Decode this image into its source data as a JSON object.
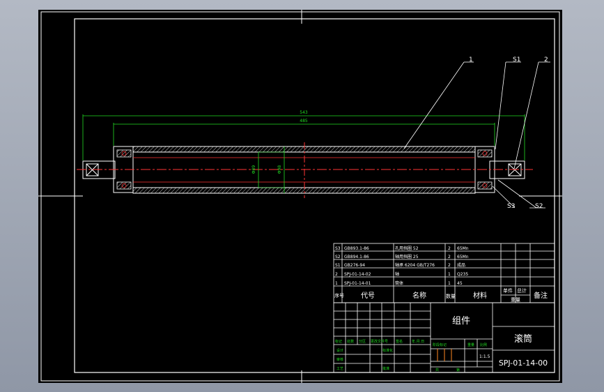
{
  "drawing": {
    "dimensions": {
      "overall_length": "543",
      "tube_length": "485",
      "inner_dia": "Φ89",
      "outer_dia": "Φ98"
    },
    "balloons": {
      "part1": "1",
      "s1": "S1",
      "part2": "2",
      "s3": "S3",
      "s2": "S2"
    }
  },
  "bom": {
    "rows": [
      {
        "no": "S3",
        "code": "GB893.1-86",
        "name": "孔用挡圈 52",
        "qty": "2",
        "material": "65Mn"
      },
      {
        "no": "S2",
        "code": "GB894.1-86",
        "name": "轴用挡圈 25",
        "qty": "2",
        "material": "65Mn"
      },
      {
        "no": "S1",
        "code": "GB276-94",
        "name": "轴承 6204 GB/T276",
        "qty": "2",
        "material": "成品"
      },
      {
        "no": "2",
        "code": "SPJ-01-14-02",
        "name": "轴",
        "qty": "1",
        "material": "Q235"
      },
      {
        "no": "1",
        "code": "SPJ-01-14-01",
        "name": "筒体",
        "qty": "1",
        "material": "45"
      }
    ],
    "headers": {
      "no": "序号",
      "code": "代号",
      "name": "名称",
      "qty": "数量",
      "material": "材料",
      "unit_weight": "单件",
      "total_weight": "总计",
      "weight": "重量",
      "remark": "备注"
    }
  },
  "title_block": {
    "assembly_label": "组件",
    "part_name": "滚筒",
    "drawing_number": "SPJ-01-14-00",
    "scale": "1:1.5",
    "rev_headers": [
      "标记",
      "处数",
      "分区",
      "更改文件号",
      "签名",
      "年.月.日"
    ],
    "signoff_labels": [
      "设计",
      "审核",
      "工艺"
    ],
    "standardization": "标准化",
    "stage_headers": [
      "阶段标记",
      "重量",
      "比例"
    ],
    "approve": "批准",
    "sheet_total": "共",
    "sheet_no": "第"
  }
}
